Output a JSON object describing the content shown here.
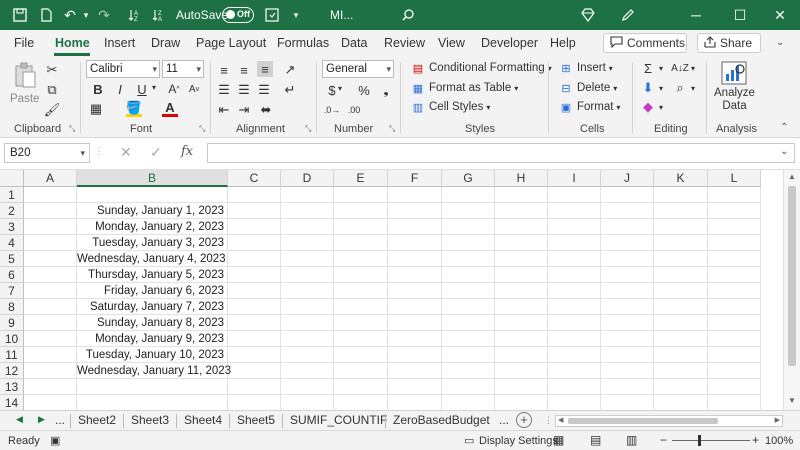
{
  "titlebar": {
    "autosave_label": "AutoSave",
    "autosave_state": "Off",
    "doc_title": "MI...",
    "accent": "#1e7145"
  },
  "tabs": [
    "File",
    "Home",
    "Insert",
    "Draw",
    "Page Layout",
    "Formulas",
    "Data",
    "Review",
    "View",
    "Developer",
    "Help"
  ],
  "active_tab": "Home",
  "comments_label": "Comments",
  "share_label": "Share",
  "ribbon": {
    "clipboard": {
      "paste": "Paste",
      "label": "Clipboard"
    },
    "font": {
      "name": "Calibri",
      "size": "11",
      "label": "Font"
    },
    "alignment": {
      "label": "Alignment"
    },
    "number": {
      "format": "General",
      "label": "Number"
    },
    "styles": {
      "conditional": "Conditional Formatting",
      "format_table": "Format as Table",
      "cell_styles": "Cell Styles",
      "label": "Styles"
    },
    "cells": {
      "insert": "Insert",
      "delete": "Delete",
      "format": "Format",
      "label": "Cells"
    },
    "editing": {
      "label": "Editing"
    },
    "analysis": {
      "analyze_line1": "Analyze",
      "analyze_line2": "Data",
      "label": "Analysis"
    }
  },
  "formula_bar": {
    "name_box": "B20",
    "fx": "fx",
    "formula": ""
  },
  "grid": {
    "columns": [
      "A",
      "B",
      "C",
      "D",
      "E",
      "F",
      "G",
      "H",
      "I",
      "J",
      "K",
      "L"
    ],
    "selected_column": "B",
    "rows": [
      "1",
      "2",
      "3",
      "4",
      "5",
      "6",
      "7",
      "8",
      "9",
      "10",
      "11",
      "12",
      "13",
      "14"
    ],
    "b_values": [
      "",
      "Sunday, January 1, 2023",
      "Monday, January 2, 2023",
      "Tuesday, January 3, 2023",
      "Wednesday, January 4, 2023",
      "Thursday, January 5, 2023",
      "Friday, January 6, 2023",
      "Saturday, January 7, 2023",
      "Sunday, January 8, 2023",
      "Monday, January 9, 2023",
      "Tuesday, January 10, 2023",
      "Wednesday, January 11, 2023",
      "",
      ""
    ]
  },
  "sheets": {
    "ellipsis_left": "...",
    "tabs": [
      "Sheet2",
      "Sheet3",
      "Sheet4",
      "Sheet5",
      "SUMIF_COUNTIF",
      "ZeroBasedBudget"
    ],
    "ellipsis_right": "..."
  },
  "status": {
    "ready": "Ready",
    "display_settings": "Display Settings",
    "zoom": "100%"
  }
}
